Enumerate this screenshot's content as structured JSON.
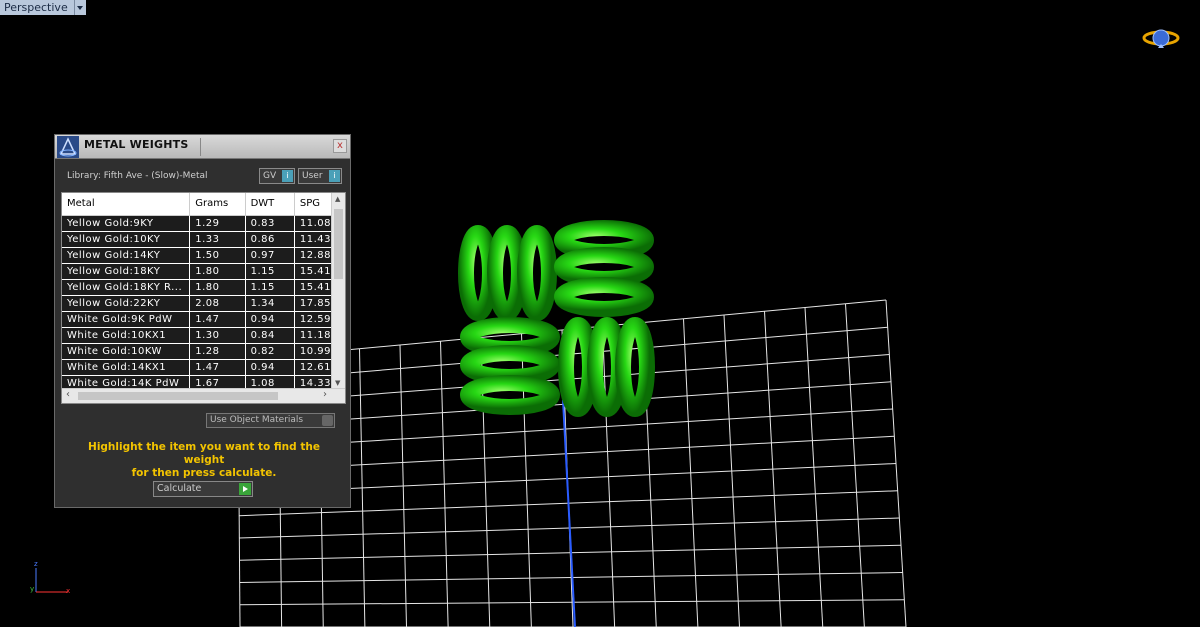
{
  "viewport": {
    "name": "Perspective"
  },
  "axes": {
    "x": "x",
    "y": "y",
    "z": "z"
  },
  "panel": {
    "title": "METAL WEIGHTS",
    "close_label": "x",
    "library_label": "Library: Fifth Ave - (Slow)-Metal",
    "gv_label": "GV",
    "user_label": "User",
    "columns": [
      "Metal",
      "Grams",
      "DWT",
      "SPG"
    ],
    "rows": [
      [
        "Yellow Gold:9KY",
        "1.29",
        "0.83",
        "11.08"
      ],
      [
        "Yellow Gold:10KY",
        "1.33",
        "0.86",
        "11.43"
      ],
      [
        "Yellow Gold:14KY",
        "1.50",
        "0.97",
        "12.88"
      ],
      [
        "Yellow Gold:18KY",
        "1.80",
        "1.15",
        "15.41"
      ],
      [
        "Yellow Gold:18KY R...",
        "1.80",
        "1.15",
        "15.41"
      ],
      [
        "Yellow Gold:22KY",
        "2.08",
        "1.34",
        "17.85"
      ],
      [
        "White Gold:9K PdW",
        "1.47",
        "0.94",
        "12.59"
      ],
      [
        "White Gold:10KX1",
        "1.30",
        "0.84",
        "11.18"
      ],
      [
        "White Gold:10KW",
        "1.28",
        "0.82",
        "10.99"
      ],
      [
        "White Gold:14KX1",
        "1.47",
        "0.94",
        "12.61"
      ],
      [
        "White Gold:14K PdW",
        "1.67",
        "1.08",
        "14.33"
      ]
    ],
    "use_object_materials_label": "Use Object Materials",
    "hint_line1": "Highlight the item you want to find the weight",
    "hint_line2": "for then press calculate.",
    "calculate_label": "Calculate"
  },
  "colors": {
    "model": "#22dd11",
    "grid": "#e6e6e6",
    "hint": "#f3c400",
    "axis": "#2a5cff"
  }
}
